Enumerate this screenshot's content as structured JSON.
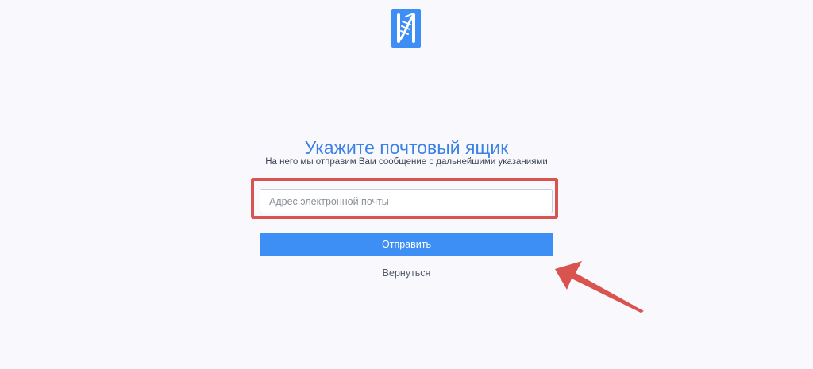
{
  "logo": {
    "icon": "brand-logo-icon",
    "color": "#3d8ef5"
  },
  "form": {
    "title": "Укажите почтовый ящик",
    "subtitle": "На него мы отправим Вам сообщение с дальнейшими указаниями",
    "email_placeholder": "Адрес электронной почты",
    "email_value": "",
    "submit_label": "Отправить",
    "back_label": "Вернуться"
  },
  "annotations": {
    "highlight_color": "#d9534f",
    "arrow_color": "#d9534f"
  },
  "colors": {
    "accent": "#3d8ef5",
    "title": "#3b82e6",
    "background": "#f9f9fd"
  }
}
